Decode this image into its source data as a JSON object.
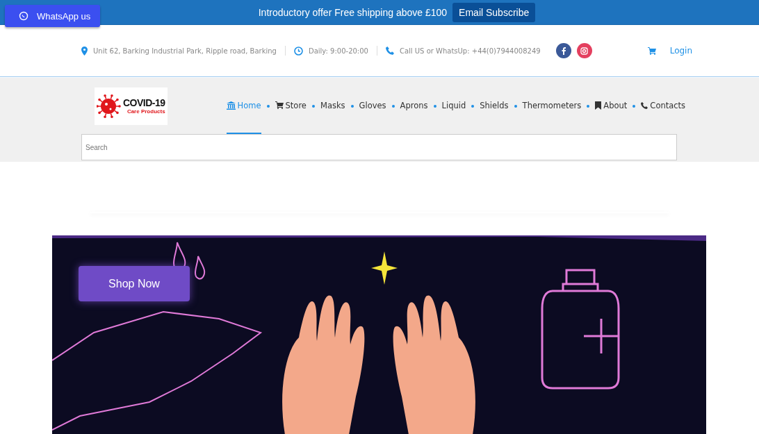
{
  "whatsapp_button": {
    "label": "WhatsApp us"
  },
  "top_bar": {
    "offer": "Introductory offer Free shipping above £100",
    "subscribe_button": "Email Subscribe"
  },
  "info_bar": {
    "address": "Unit 62, Barking Industrial Park, Ripple road, Barking",
    "hours": "Daily: 9:00-20:00",
    "phone": "Call US or WhatsUp: +44(0)7944008249",
    "login": "Login"
  },
  "logo": {
    "title": "COVID-19",
    "subtitle": "Care Products"
  },
  "nav": [
    {
      "label": "Home",
      "kind": "home",
      "selected": true
    },
    {
      "label": "Store",
      "kind": "cart",
      "selected": false
    },
    {
      "label": "Masks",
      "kind": "plain",
      "selected": false
    },
    {
      "label": "Gloves",
      "kind": "plain",
      "selected": false
    },
    {
      "label": "Aprons",
      "kind": "plain",
      "selected": false
    },
    {
      "label": "Liquid",
      "kind": "plain",
      "selected": false
    },
    {
      "label": "Shields",
      "kind": "plain",
      "selected": false
    },
    {
      "label": "Thermometers",
      "kind": "plain",
      "selected": false
    },
    {
      "label": "About",
      "kind": "bookmark",
      "selected": false
    },
    {
      "label": "Contacts",
      "kind": "phone",
      "selected": false
    }
  ],
  "search": {
    "placeholder": "Search"
  },
  "hero": {
    "button": "Shop Now"
  }
}
